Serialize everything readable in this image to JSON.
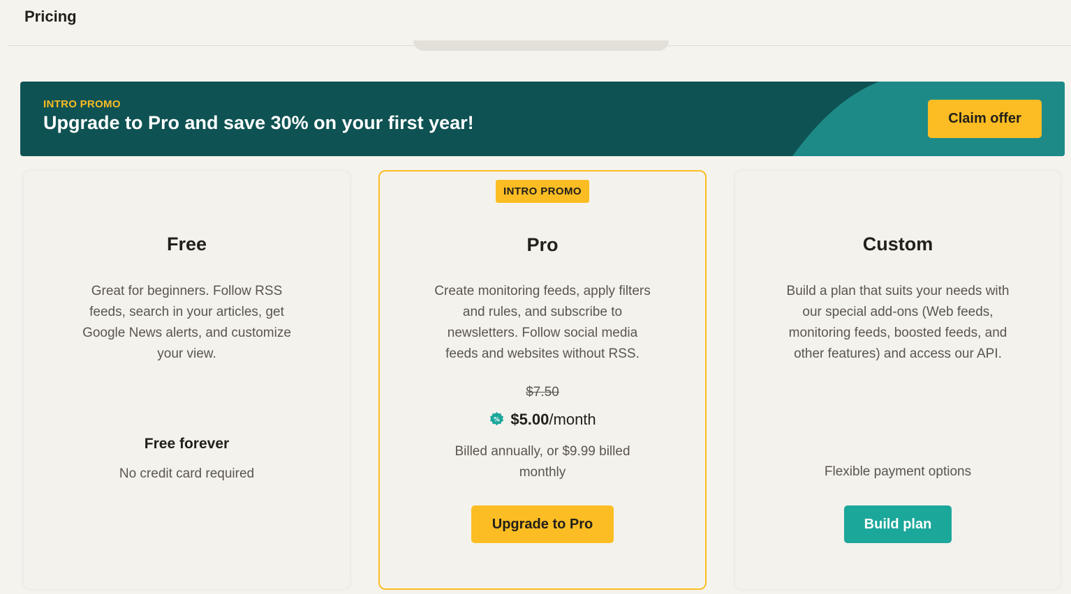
{
  "header": {
    "title": "Pricing"
  },
  "promo": {
    "eyebrow": "INTRO PROMO",
    "headline": "Upgrade to Pro and save 30% on your first year!",
    "cta_label": "Claim offer",
    "colors": {
      "background": "#0f5253",
      "accent_shape": "#1e8a88",
      "eyebrow": "#fbbd23",
      "button": "#fbbd23"
    }
  },
  "plans": {
    "free": {
      "name": "Free",
      "description": "Great for beginners. Follow RSS feeds, search in your articles, get Google News alerts, and customize your view.",
      "price_title": "Free forever",
      "price_note": "No credit card required"
    },
    "pro": {
      "badge": "INTRO PROMO",
      "name": "Pro",
      "description": "Create monitoring feeds, apply filters and rules, and subscribe to newsletters. Follow social media feeds and websites without RSS.",
      "old_price": "$7.50",
      "price": "$5.00",
      "price_unit": "/month",
      "discount_icon": "percent-badge-icon",
      "billing_note": "Billed annually, or $9.99 billed monthly",
      "cta_label": "Upgrade to Pro",
      "highlight_color": "#fbbd23"
    },
    "custom": {
      "name": "Custom",
      "description": "Build a plan that suits your needs with our special add-ons (Web feeds, monitoring feeds, boosted feeds, and other features) and access our API.",
      "payment_note": "Flexible payment options",
      "cta_label": "Build plan",
      "button_color": "#1ca79b"
    }
  }
}
